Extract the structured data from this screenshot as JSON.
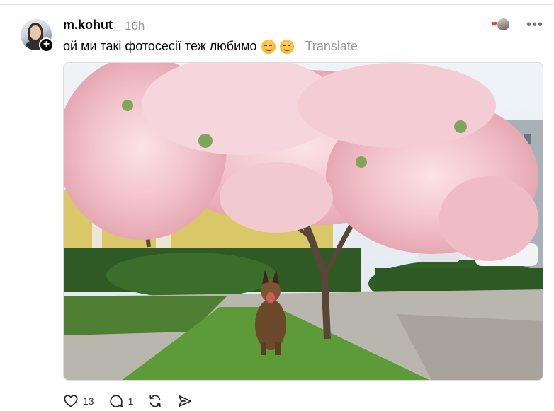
{
  "post": {
    "username": "m.kohut_",
    "timestamp": "16h",
    "text": "ой ми такі фотосесії теж любимо",
    "translate_label": "Translate",
    "more_label": "•••",
    "follow_badge": "+"
  },
  "image": {
    "description_icon": "photo-icon"
  },
  "actions": {
    "like_count": "13",
    "reply_count": "1"
  },
  "colors": {
    "heart": "#ff3040",
    "muted_text": "#999999"
  }
}
